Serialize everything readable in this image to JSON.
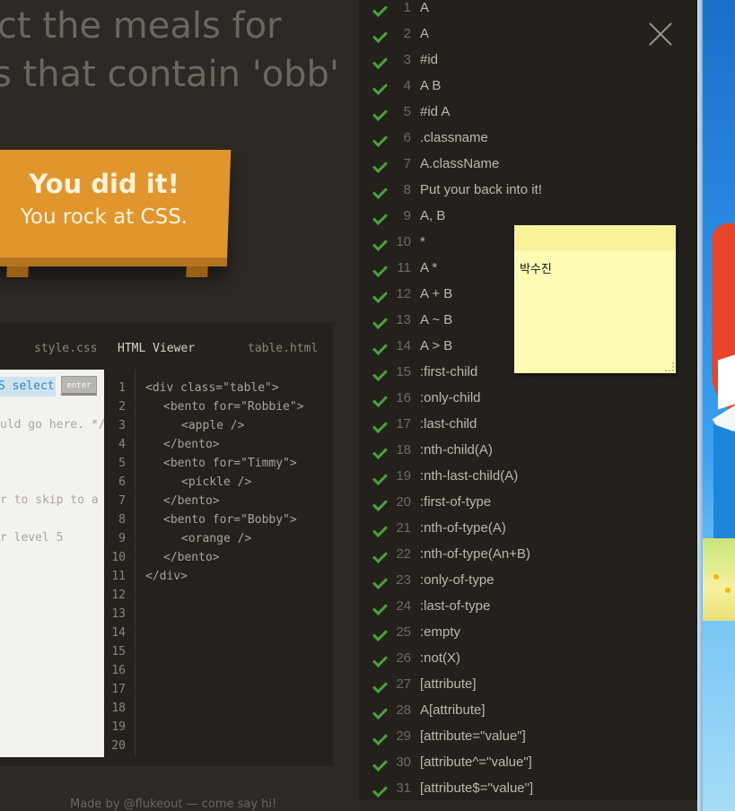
{
  "heading": {
    "line1": "ct the meals for",
    "line2": "s that contain 'obb'"
  },
  "banner": {
    "line1": "You did it!",
    "line2": "You rock at CSS."
  },
  "editor": {
    "tabs": [
      "style.css",
      "HTML Viewer",
      "table.html"
    ],
    "css_input_value": "S selectc",
    "enter_label": "enter",
    "css_comment_lines": [
      "uld go here. */",
      "r to skip to a",
      "r level 5"
    ],
    "line_numbers": [
      "1",
      "2",
      "3",
      "4",
      "5",
      "6",
      "7",
      "8",
      "9",
      "10",
      "11",
      "12",
      "13",
      "14",
      "15",
      "16",
      "17",
      "18",
      "19",
      "20"
    ],
    "html_lines": [
      "<div class=\"table\">",
      "<bento for=\"Robbie\">",
      "<apple />",
      "</bento>",
      "<bento for=\"Timmy\">",
      "<pickle />",
      "</bento>",
      "<bento for=\"Bobby\">",
      "<orange />",
      "</bento>",
      "</div>"
    ]
  },
  "footer": {
    "text": "Made by @flukeout — come say hi!"
  },
  "levels": [
    {
      "num": "1",
      "name": "A"
    },
    {
      "num": "2",
      "name": "A"
    },
    {
      "num": "3",
      "name": "#id"
    },
    {
      "num": "4",
      "name": "A  B"
    },
    {
      "num": "5",
      "name": "#id  A"
    },
    {
      "num": "6",
      "name": ".classname"
    },
    {
      "num": "7",
      "name": "A.className"
    },
    {
      "num": "8",
      "name": "Put your back into it!"
    },
    {
      "num": "9",
      "name": "A, B"
    },
    {
      "num": "10",
      "name": "*"
    },
    {
      "num": "11",
      "name": "A  *"
    },
    {
      "num": "12",
      "name": "A + B"
    },
    {
      "num": "13",
      "name": "A ~ B"
    },
    {
      "num": "14",
      "name": "A > B"
    },
    {
      "num": "15",
      "name": ":first-child"
    },
    {
      "num": "16",
      "name": ":only-child"
    },
    {
      "num": "17",
      "name": ":last-child"
    },
    {
      "num": "18",
      "name": ":nth-child(A)"
    },
    {
      "num": "19",
      "name": ":nth-last-child(A)"
    },
    {
      "num": "20",
      "name": ":first-of-type"
    },
    {
      "num": "21",
      "name": ":nth-of-type(A)"
    },
    {
      "num": "22",
      "name": ":nth-of-type(An+B)"
    },
    {
      "num": "23",
      "name": ":only-of-type"
    },
    {
      "num": "24",
      "name": ":last-of-type"
    },
    {
      "num": "25",
      "name": ":empty"
    },
    {
      "num": "26",
      "name": ":not(X)"
    },
    {
      "num": "27",
      "name": "[attribute]"
    },
    {
      "num": "28",
      "name": "A[attribute]"
    },
    {
      "num": "29",
      "name": "[attribute=\"value\"]"
    },
    {
      "num": "30",
      "name": "[attribute^=\"value\"]"
    },
    {
      "num": "31",
      "name": "[attribute$=\"value\"]"
    }
  ],
  "sticky_note": {
    "text": "박수진"
  },
  "icons": {
    "close": "close-icon",
    "check": "check-icon"
  },
  "colors": {
    "check_green": "#4aa03a",
    "banner_orange": "#e0962c",
    "sticky_yellow": "#fdfcb2"
  }
}
